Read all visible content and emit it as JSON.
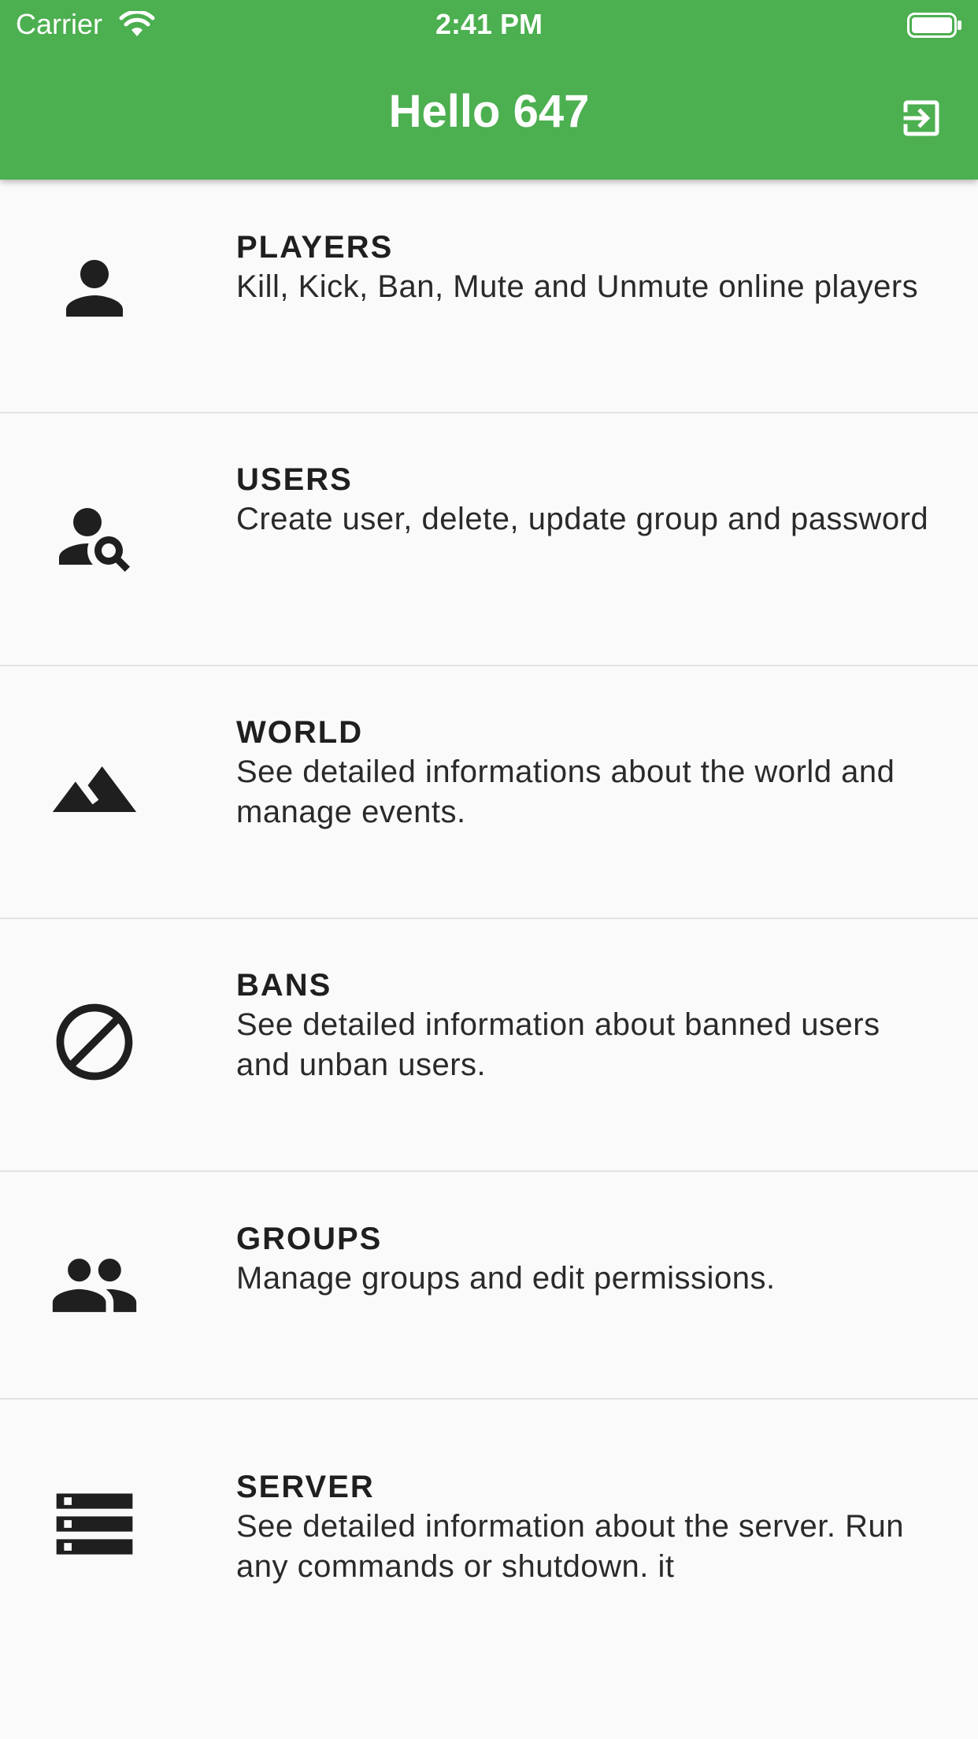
{
  "status_bar": {
    "carrier": "Carrier",
    "time": "2:41 PM"
  },
  "app_bar": {
    "title": "Hello 647",
    "background_color": "#4caf50",
    "action_icon": "logout-icon"
  },
  "menu": {
    "items": [
      {
        "icon": "person-icon",
        "title": "PLAYERS",
        "description": "Kill, Kick, Ban, Mute and Unmute online players"
      },
      {
        "icon": "person-search-icon",
        "title": "USERS",
        "description": "Create user, delete, update group and password"
      },
      {
        "icon": "terrain-icon",
        "title": "WORLD",
        "description": "See detailed informations about the world and manage events."
      },
      {
        "icon": "block-icon",
        "title": "BANS",
        "description": "See detailed information about banned users and unban users."
      },
      {
        "icon": "people-icon",
        "title": "GROUPS",
        "description": "Manage groups and edit permissions."
      },
      {
        "icon": "storage-icon",
        "title": "SERVER",
        "description": "See detailed information about the server. Run any commands or shutdown. it"
      }
    ]
  }
}
